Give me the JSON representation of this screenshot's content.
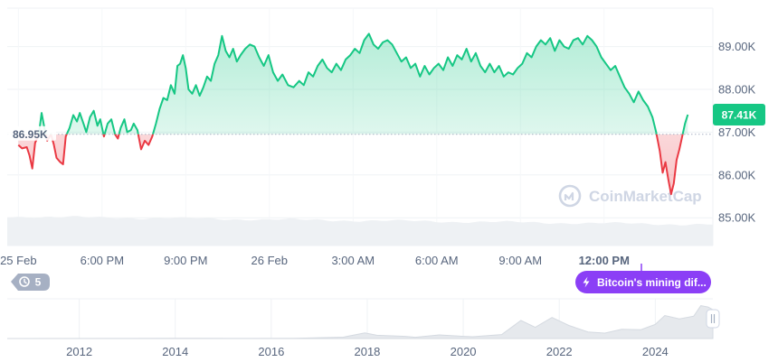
{
  "brand": {
    "watermark": "CoinMarketCap",
    "up_color": "#16c784",
    "down_color": "#ea3943",
    "event_color": "#8b3ff6",
    "badge_color": "#a6b0c3"
  },
  "chart_data": {
    "type": "area",
    "title": "",
    "baseline": 86.95,
    "baseline_label": "86.95K",
    "current_value": 87.41,
    "current_label": "87.41K",
    "ylim": [
      84.35,
      89.9
    ],
    "y_ticks": [
      {
        "value": 85.0,
        "label": "85.00K"
      },
      {
        "value": 86.0,
        "label": "86.00K"
      },
      {
        "value": 87.0,
        "label": "87.00K"
      },
      {
        "value": 88.0,
        "label": "88.00K"
      },
      {
        "value": 89.0,
        "label": "89.00K"
      }
    ],
    "x_unit": "hours since 25 Feb 00:00",
    "xlim": [
      -0.6,
      37.35
    ],
    "x_ticks": [
      {
        "x": 0,
        "label": "25 Feb",
        "bold": false
      },
      {
        "x": 4.5,
        "label": "6:00 PM",
        "bold": false
      },
      {
        "x": 9,
        "label": "9:00 PM",
        "bold": false
      },
      {
        "x": 13.5,
        "label": "26 Feb",
        "bold": false
      },
      {
        "x": 18,
        "label": "3:00 AM",
        "bold": false
      },
      {
        "x": 22.5,
        "label": "6:00 AM",
        "bold": false
      },
      {
        "x": 27,
        "label": "9:00 AM",
        "bold": false
      },
      {
        "x": 31.5,
        "label": "12:00 PM",
        "bold": true
      }
    ],
    "series": [
      {
        "points": [
          [
            0.0,
            86.7
          ],
          [
            0.2,
            86.62
          ],
          [
            0.45,
            86.65
          ],
          [
            0.6,
            86.45
          ],
          [
            0.75,
            86.15
          ],
          [
            0.9,
            86.75
          ],
          [
            1.1,
            86.95
          ],
          [
            1.25,
            87.45
          ],
          [
            1.4,
            87.1
          ],
          [
            1.55,
            86.8
          ],
          [
            1.75,
            86.95
          ],
          [
            1.9,
            86.72
          ],
          [
            2.05,
            86.4
          ],
          [
            2.25,
            86.3
          ],
          [
            2.4,
            86.25
          ],
          [
            2.55,
            86.9
          ],
          [
            2.75,
            87.1
          ],
          [
            2.95,
            87.4
          ],
          [
            3.15,
            87.25
          ],
          [
            3.3,
            87.45
          ],
          [
            3.5,
            87.2
          ],
          [
            3.65,
            87.0
          ],
          [
            3.85,
            87.35
          ],
          [
            4.05,
            87.5
          ],
          [
            4.25,
            87.15
          ],
          [
            4.4,
            87.3
          ],
          [
            4.6,
            86.9
          ],
          [
            4.8,
            87.2
          ],
          [
            5.0,
            87.3
          ],
          [
            5.2,
            86.95
          ],
          [
            5.35,
            86.85
          ],
          [
            5.5,
            87.1
          ],
          [
            5.7,
            87.3
          ],
          [
            5.85,
            87.0
          ],
          [
            6.05,
            87.05
          ],
          [
            6.2,
            87.2
          ],
          [
            6.4,
            87.05
          ],
          [
            6.6,
            86.6
          ],
          [
            6.8,
            86.8
          ],
          [
            7.0,
            86.7
          ],
          [
            7.2,
            86.9
          ],
          [
            7.4,
            87.2
          ],
          [
            7.6,
            87.55
          ],
          [
            7.8,
            87.8
          ],
          [
            8.0,
            87.75
          ],
          [
            8.2,
            88.1
          ],
          [
            8.4,
            87.9
          ],
          [
            8.55,
            88.55
          ],
          [
            8.7,
            88.6
          ],
          [
            8.85,
            88.8
          ],
          [
            9.0,
            88.5
          ],
          [
            9.15,
            88.0
          ],
          [
            9.35,
            87.9
          ],
          [
            9.55,
            88.1
          ],
          [
            9.75,
            87.85
          ],
          [
            9.95,
            88.05
          ],
          [
            10.15,
            88.3
          ],
          [
            10.35,
            88.2
          ],
          [
            10.55,
            88.6
          ],
          [
            10.75,
            88.8
          ],
          [
            10.95,
            89.25
          ],
          [
            11.15,
            88.9
          ],
          [
            11.35,
            88.75
          ],
          [
            11.55,
            88.95
          ],
          [
            11.75,
            88.65
          ],
          [
            11.95,
            88.8
          ],
          [
            12.2,
            88.95
          ],
          [
            12.45,
            89.05
          ],
          [
            12.7,
            89.0
          ],
          [
            12.95,
            88.75
          ],
          [
            13.2,
            88.55
          ],
          [
            13.45,
            88.8
          ],
          [
            13.7,
            88.4
          ],
          [
            13.95,
            88.2
          ],
          [
            14.2,
            88.35
          ],
          [
            14.5,
            88.1
          ],
          [
            14.8,
            88.05
          ],
          [
            15.1,
            88.2
          ],
          [
            15.35,
            88.1
          ],
          [
            15.6,
            88.4
          ],
          [
            15.85,
            88.3
          ],
          [
            16.1,
            88.55
          ],
          [
            16.35,
            88.7
          ],
          [
            16.6,
            88.5
          ],
          [
            16.85,
            88.4
          ],
          [
            17.1,
            88.6
          ],
          [
            17.35,
            88.45
          ],
          [
            17.6,
            88.7
          ],
          [
            17.85,
            88.8
          ],
          [
            18.1,
            88.95
          ],
          [
            18.35,
            88.85
          ],
          [
            18.6,
            89.15
          ],
          [
            18.85,
            89.3
          ],
          [
            19.1,
            89.05
          ],
          [
            19.35,
            88.95
          ],
          [
            19.6,
            89.1
          ],
          [
            19.85,
            89.15
          ],
          [
            20.1,
            89.05
          ],
          [
            20.35,
            88.85
          ],
          [
            20.6,
            88.65
          ],
          [
            20.85,
            88.75
          ],
          [
            21.1,
            88.5
          ],
          [
            21.35,
            88.6
          ],
          [
            21.6,
            88.3
          ],
          [
            21.85,
            88.55
          ],
          [
            22.1,
            88.35
          ],
          [
            22.35,
            88.5
          ],
          [
            22.6,
            88.6
          ],
          [
            22.85,
            88.45
          ],
          [
            23.1,
            88.75
          ],
          [
            23.35,
            88.55
          ],
          [
            23.6,
            88.8
          ],
          [
            23.85,
            88.7
          ],
          [
            24.1,
            88.95
          ],
          [
            24.35,
            88.65
          ],
          [
            24.6,
            88.85
          ],
          [
            24.85,
            88.55
          ],
          [
            25.1,
            88.4
          ],
          [
            25.35,
            88.6
          ],
          [
            25.6,
            88.4
          ],
          [
            25.85,
            88.55
          ],
          [
            26.1,
            88.3
          ],
          [
            26.35,
            88.4
          ],
          [
            26.6,
            88.35
          ],
          [
            26.85,
            88.5
          ],
          [
            27.1,
            88.6
          ],
          [
            27.35,
            88.85
          ],
          [
            27.6,
            88.75
          ],
          [
            27.85,
            89.0
          ],
          [
            28.1,
            89.15
          ],
          [
            28.35,
            89.05
          ],
          [
            28.6,
            89.2
          ],
          [
            28.85,
            88.9
          ],
          [
            29.1,
            89.15
          ],
          [
            29.35,
            89.0
          ],
          [
            29.6,
            88.95
          ],
          [
            29.85,
            89.15
          ],
          [
            30.1,
            89.2
          ],
          [
            30.35,
            89.05
          ],
          [
            30.6,
            89.25
          ],
          [
            30.85,
            89.15
          ],
          [
            31.1,
            89.0
          ],
          [
            31.35,
            88.75
          ],
          [
            31.6,
            88.6
          ],
          [
            31.85,
            88.45
          ],
          [
            32.1,
            88.55
          ],
          [
            32.35,
            88.3
          ],
          [
            32.6,
            88.05
          ],
          [
            32.85,
            87.9
          ],
          [
            33.1,
            87.7
          ],
          [
            33.35,
            87.95
          ],
          [
            33.6,
            87.75
          ],
          [
            33.85,
            87.6
          ],
          [
            34.1,
            87.35
          ],
          [
            34.3,
            87.0
          ],
          [
            34.5,
            86.55
          ],
          [
            34.65,
            86.05
          ],
          [
            34.8,
            86.3
          ],
          [
            34.95,
            85.9
          ],
          [
            35.1,
            85.55
          ],
          [
            35.25,
            85.8
          ],
          [
            35.4,
            86.35
          ],
          [
            35.55,
            86.6
          ],
          [
            35.7,
            86.9
          ],
          [
            35.85,
            87.2
          ],
          [
            36.0,
            87.41
          ]
        ]
      }
    ],
    "volume": {
      "note": "relative volume band under the price area",
      "level": 0.7
    },
    "overview": {
      "x_ticks": [
        {
          "year": 2012,
          "label": "2012"
        },
        {
          "year": 2014,
          "label": "2014"
        },
        {
          "year": 2016,
          "label": "2016"
        },
        {
          "year": 2018,
          "label": "2018"
        },
        {
          "year": 2020,
          "label": "2020"
        },
        {
          "year": 2022,
          "label": "2022"
        },
        {
          "year": 2024,
          "label": "2024"
        }
      ],
      "xlim": [
        2010.5,
        2025.2
      ],
      "ylim": [
        0,
        110000
      ],
      "points": [
        [
          2010.5,
          0
        ],
        [
          2013.0,
          200
        ],
        [
          2013.9,
          900
        ],
        [
          2014.5,
          600
        ],
        [
          2015.5,
          300
        ],
        [
          2016.5,
          700
        ],
        [
          2017.5,
          4000
        ],
        [
          2017.95,
          17000
        ],
        [
          2018.2,
          10000
        ],
        [
          2018.8,
          6500
        ],
        [
          2019.0,
          3800
        ],
        [
          2019.5,
          11000
        ],
        [
          2019.9,
          7500
        ],
        [
          2020.2,
          5500
        ],
        [
          2020.8,
          12000
        ],
        [
          2021.2,
          55000
        ],
        [
          2021.5,
          34000
        ],
        [
          2021.85,
          64000
        ],
        [
          2022.2,
          40000
        ],
        [
          2022.6,
          20000
        ],
        [
          2022.95,
          16500
        ],
        [
          2023.3,
          28000
        ],
        [
          2023.7,
          27000
        ],
        [
          2024.0,
          43000
        ],
        [
          2024.2,
          70000
        ],
        [
          2024.5,
          60000
        ],
        [
          2024.8,
          68000
        ],
        [
          2024.95,
          100000
        ],
        [
          2025.1,
          96000
        ],
        [
          2025.2,
          88000
        ]
      ],
      "handle_icon": "pause-bars-icon"
    },
    "events": {
      "history_badge_icon": "history-icon",
      "history_badge_count": "5",
      "event_icon": "lightning-icon",
      "event_text": "Bitcoin's mining dif..."
    }
  }
}
